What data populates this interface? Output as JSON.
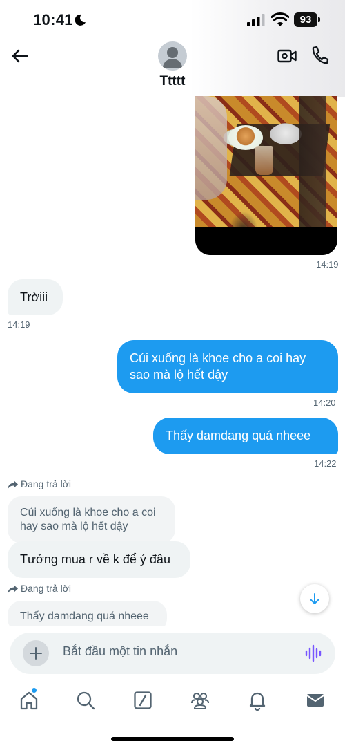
{
  "status_bar": {
    "time": "10:41",
    "battery": "93"
  },
  "header": {
    "contact_name": "Ttttt"
  },
  "messages": {
    "image_time": "14:19",
    "m1": {
      "text": "Trờiii",
      "time": "14:19"
    },
    "m2": {
      "text_line1": "Cúi xuống là khoe cho a coi hay",
      "text_line2": "sao mà lộ hết dậy",
      "time": "14:20"
    },
    "m3": {
      "text": "Thấy damdang quá nheee",
      "time": "14:22"
    },
    "m4": {
      "reply_label": "Đang trả lời",
      "quoted_line1": "Cúi xuống là khoe cho a coi",
      "quoted_line2": "hay sao mà lộ hết dậy",
      "text": "Tưởng mua r về k để ý đâu"
    },
    "m5": {
      "reply_label": "Đang trả lời",
      "quoted": "Thấy damdang quá nheee"
    }
  },
  "composer": {
    "placeholder": "Bắt đầu một tin nhắn"
  },
  "colors": {
    "accent": "#1d9bf0",
    "incoming_bubble": "#eff3f4",
    "text": "#0f1419",
    "muted": "#536471"
  },
  "icons": {
    "back": "arrow-left-icon",
    "video": "video-call-icon",
    "phone": "phone-icon",
    "scroll": "arrow-down-icon",
    "plus": "plus-icon",
    "voice": "voice-wave-icon",
    "nav": [
      "home-icon",
      "search-icon",
      "grok-icon",
      "communities-icon",
      "bell-icon",
      "mail-icon"
    ]
  }
}
